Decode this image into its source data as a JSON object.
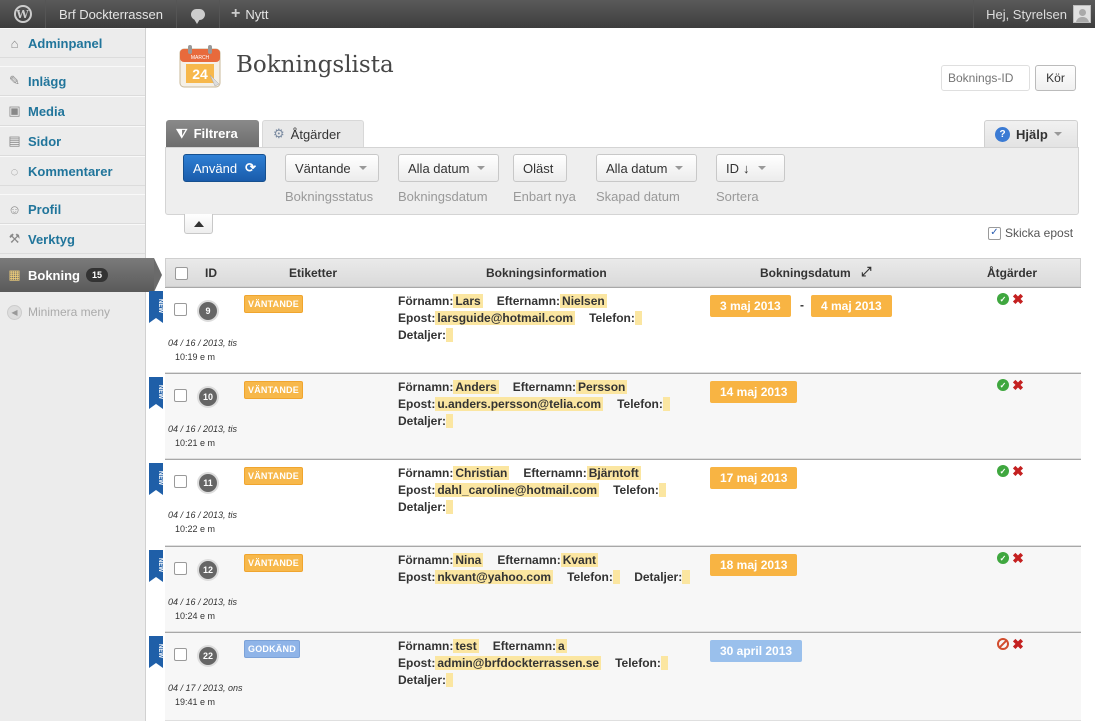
{
  "adminbar": {
    "site_name": "Brf Dockterrassen",
    "new_label": "Nytt",
    "greeting": "Hej, Styrelsen"
  },
  "sidebar": {
    "items": [
      {
        "label": "Adminpanel",
        "icon": "home-icon"
      },
      {
        "label": "Inlägg",
        "icon": "pin-icon"
      },
      {
        "label": "Media",
        "icon": "media-icon"
      },
      {
        "label": "Sidor",
        "icon": "pages-icon"
      },
      {
        "label": "Kommentarer",
        "icon": "comments-icon"
      },
      {
        "label": "Profil",
        "icon": "users-icon"
      },
      {
        "label": "Verktyg",
        "icon": "tools-icon"
      },
      {
        "label": "Bokning",
        "icon": "calendar-icon",
        "badge": "15"
      }
    ],
    "collapse_label": "Minimera meny"
  },
  "header": {
    "title": "Bokningslista",
    "calendar_month": "MARCH",
    "calendar_day": "24",
    "id_placeholder": "Boknings-ID",
    "go_label": "Kör"
  },
  "tabs": {
    "filter": "Filtrera",
    "actions": "Åtgärder",
    "help": "Hjälp"
  },
  "filters": {
    "apply": "Använd",
    "status": {
      "value": "Väntande",
      "label": "Bokningsstatus"
    },
    "booking_date": {
      "value": "Alla datum",
      "label": "Bokningsdatum"
    },
    "unread": {
      "value": "Oläst",
      "label": "Enbart nya"
    },
    "created_date": {
      "value": "Alla datum",
      "label": "Skapad datum"
    },
    "sort": {
      "value": "ID",
      "label": "Sortera"
    }
  },
  "send_email_label": "Skicka epost",
  "columns": {
    "id": "ID",
    "tags": "Etiketter",
    "info": "Bokningsinformation",
    "date": "Bokningsdatum",
    "actions": "Åtgärder"
  },
  "labels": {
    "first": "Förnamn:",
    "last": "Efternamn:",
    "email": "Epost:",
    "phone": "Telefon:",
    "details": "Detaljer:",
    "new_ribbon": "NEW",
    "dash": "-"
  },
  "rows": [
    {
      "id": "9",
      "tag": "VÄNTANDE",
      "created_date": "04 / 16 / 2013, tis",
      "created_time": "10:19 e m",
      "first": "Lars",
      "last": "Nielsen",
      "email": "larsguide@hotmail.com",
      "phone": "",
      "details": "",
      "date_from": "3 maj 2013",
      "date_to": "4 maj 2013"
    },
    {
      "id": "10",
      "tag": "VÄNTANDE",
      "created_date": "04 / 16 / 2013, tis",
      "created_time": "10:21 e m",
      "first": "Anders",
      "last": "Persson",
      "email": "u.anders.persson@telia.com",
      "phone": "",
      "details": "",
      "date_from": "14 maj 2013"
    },
    {
      "id": "11",
      "tag": "VÄNTANDE",
      "created_date": "04 / 16 / 2013, tis",
      "created_time": "10:22 e m",
      "first": "Christian",
      "last": "Bjärntoft",
      "email": "dahl_caroline@hotmail.com",
      "phone": "",
      "details": "",
      "date_from": "17 maj 2013"
    },
    {
      "id": "12",
      "tag": "VÄNTANDE",
      "created_date": "04 / 16 / 2013, tis",
      "created_time": "10:24 e m",
      "first": "Nina",
      "last": "Kvant",
      "email": "nkvant@yahoo.com",
      "phone": "",
      "details": "",
      "date_from": "18 maj 2013"
    },
    {
      "id": "22",
      "tag": "GODKÄND",
      "created_date": "04 / 17 / 2013, ons",
      "created_time": "19:41 e m",
      "first": "test",
      "last": "a",
      "email": "admin@brfdockterrassen.se",
      "phone": "",
      "details": "",
      "date_from": "30 april 2013"
    }
  ]
}
